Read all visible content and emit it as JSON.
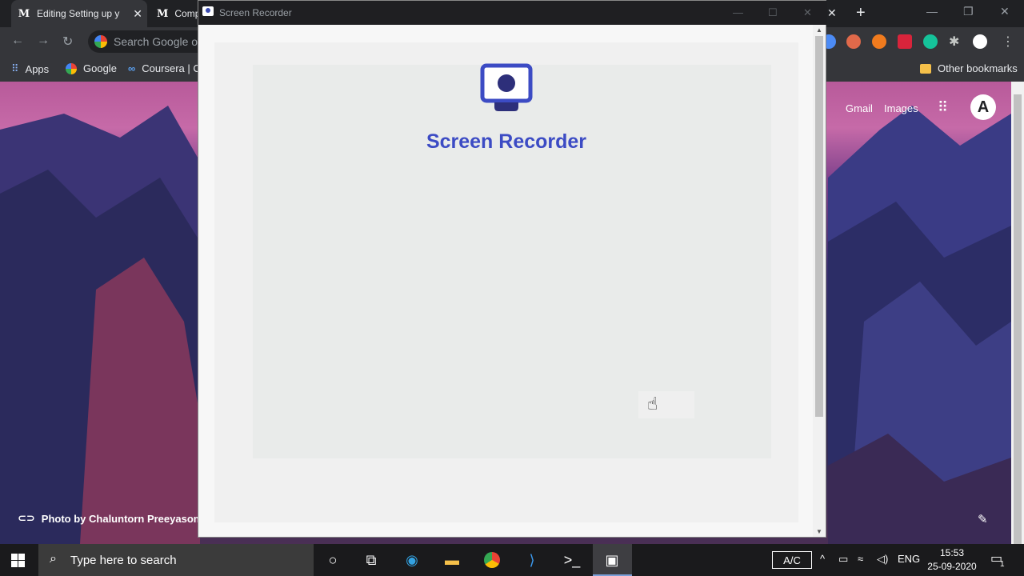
{
  "browser": {
    "tabs": [
      {
        "favicon": "M",
        "title": "Editing Setting up y"
      },
      {
        "favicon": "M",
        "title": "Comp"
      }
    ],
    "omnibox_placeholder": "Search Google or",
    "bookmarks": [
      {
        "icon": "apps-grid-icon",
        "label": "Apps"
      },
      {
        "icon": "google-icon",
        "label": "Google"
      },
      {
        "icon": "coursera-icon",
        "label": "Coursera | C"
      }
    ],
    "other_bookmarks": "Other bookmarks",
    "new_tab_links": {
      "gmail": "Gmail",
      "images": "Images"
    },
    "avatar_letter": "A",
    "photo_credit": "Photo by Chaluntorn Preeyasomb"
  },
  "popup": {
    "window_title": "Screen Recorder",
    "app_title": "Screen Recorder",
    "accent_color": "#3c4bc4"
  },
  "taskbar": {
    "search_placeholder": "Type here to search",
    "ac_label": "A/C",
    "language": "ENG",
    "time": "15:53",
    "date": "25-09-2020",
    "notifications": "1"
  }
}
